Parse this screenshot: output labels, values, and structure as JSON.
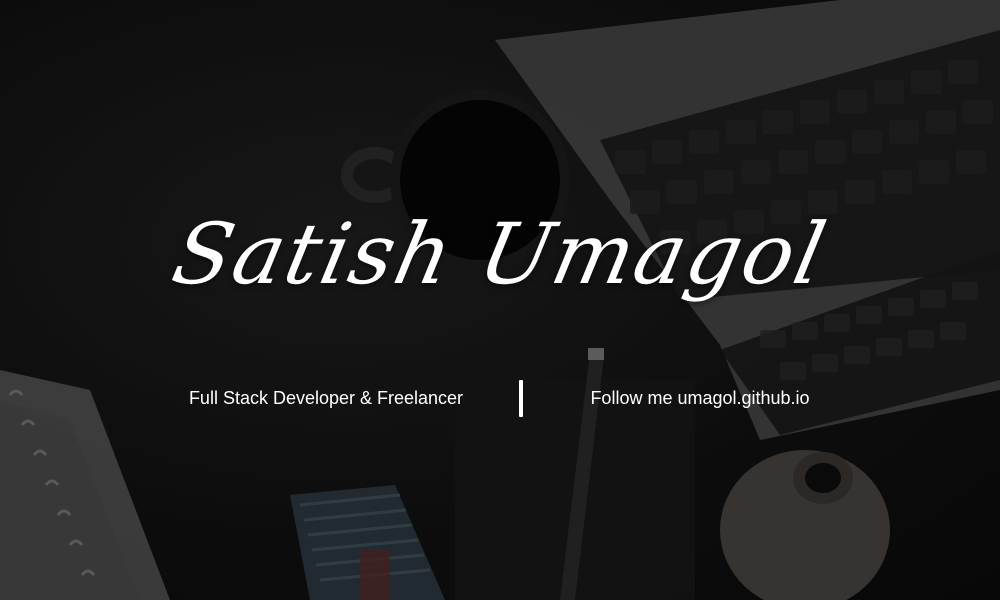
{
  "banner": {
    "name": "Satish Umagol",
    "tagline": "Full Stack Developer & Freelancer",
    "follow_text": "Follow me umagol.github.io"
  },
  "colors": {
    "background": "#141414",
    "text": "#ffffff",
    "laptop": "#5a5a5a",
    "keyboard": "#1e1e1e"
  },
  "background_objects": [
    "laptop",
    "coffee-mug",
    "spiral-notebook",
    "pencil",
    "striped-notebook",
    "ceramic-vase"
  ]
}
